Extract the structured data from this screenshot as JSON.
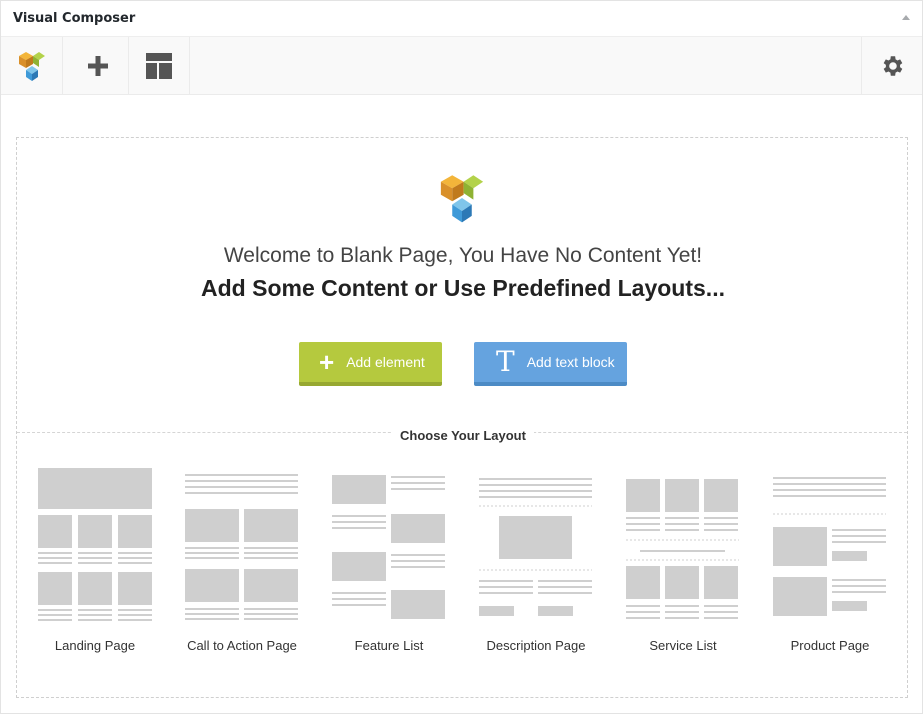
{
  "panel": {
    "title": "Visual Composer"
  },
  "welcome": {
    "line1": "Welcome to Blank Page, You Have No Content Yet!",
    "line2": "Add Some Content or Use Predefined Layouts..."
  },
  "buttons": {
    "add_element": "Add element",
    "add_element_icon": "+",
    "add_text_block": "Add text block",
    "add_text_block_icon": "T"
  },
  "layouts_label": "Choose Your Layout",
  "layouts": [
    {
      "label": "Landing Page"
    },
    {
      "label": "Call to Action Page"
    },
    {
      "label": "Feature List"
    },
    {
      "label": "Description Page"
    },
    {
      "label": "Service List"
    },
    {
      "label": "Product Page"
    }
  ],
  "colors": {
    "green": "#b5c93e",
    "blue": "#65a3df",
    "thumb_gray": "#cfcfcf"
  }
}
